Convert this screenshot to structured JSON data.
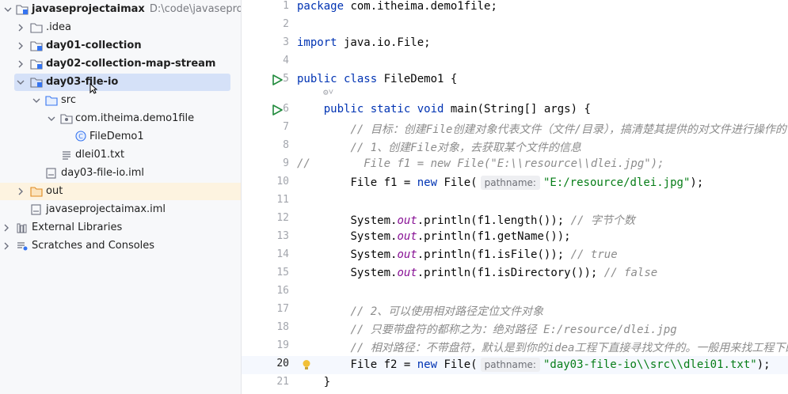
{
  "project_tree": {
    "root": {
      "name": "javaseprojectaimax",
      "path": "D:\\code\\javaseprojectai"
    },
    "items": [
      {
        "label": ".idea"
      },
      {
        "label": "day01-collection"
      },
      {
        "label": "day02-collection-map-stream"
      },
      {
        "label": "day03-file-io"
      },
      {
        "label": "src"
      },
      {
        "label": "com.itheima.demo1file"
      },
      {
        "label": "FileDemo1"
      },
      {
        "label": "dlei01.txt"
      },
      {
        "label": "day03-file-io.iml"
      },
      {
        "label": "out"
      },
      {
        "label": "javaseprojectaimax.iml"
      },
      {
        "label": "External Libraries"
      },
      {
        "label": "Scratches and Consoles"
      }
    ]
  },
  "editor": {
    "line_numbers": [
      "1",
      "2",
      "3",
      "4",
      "5",
      "6",
      "7",
      "8",
      "9",
      "10",
      "11",
      "12",
      "13",
      "14",
      "15",
      "16",
      "17",
      "18",
      "19",
      "20",
      "21"
    ],
    "code": {
      "l1_kw": "package",
      "l1_rest": " com.itheima.demo1file;",
      "l3_kw": "import",
      "l3_rest": " java.io.File;",
      "l5_kw": "public class",
      "l5_rest": " FileDemo1 {",
      "l5b": "⚙˅",
      "l6_kw": "public static void",
      "l6_rest": " main(String[] args) {",
      "l7_cmt": "// 目标：创建File创建对象代表文件（文件/目录），搞清楚其提供的对文件进行操作的",
      "l8_cmt": "// 1、创建File对象，去获取某个文件的信息",
      "l9_cmt": "//        File f1 = new File(\"E:\\\\resource\\\\dlei.jpg\");",
      "l10_a": "File f1 = ",
      "l10_kw": "new",
      "l10_b": " File(",
      "l10_hint": "pathname:",
      "l10_str": "\"E:/resource/dlei.jpg\"",
      "l10_c": ");",
      "l12_a": "System.",
      "l12_out": "out",
      "l12_b": ".println(f1.length()); ",
      "l12_cmt": "// 字节个数",
      "l13_a": "System.",
      "l13_out": "out",
      "l13_b": ".println(f1.getName());",
      "l14_a": "System.",
      "l14_out": "out",
      "l14_b": ".println(f1.isFile()); ",
      "l14_cmt": "// true",
      "l15_a": "System.",
      "l15_out": "out",
      "l15_b": ".println(f1.isDirectory()); ",
      "l15_cmt": "// false",
      "l17_cmt": "// 2、可以使用相对路径定位文件对象",
      "l18_cmt": "// 只要带盘符的都称之为：绝对路径 E:/resource/dlei.jpg",
      "l19_cmt": "// 相对路径：不带盘符，默认是到你的idea工程下直接寻找文件的。一般用来找工程下的",
      "l20_a": "File f2 = ",
      "l20_kw": "new",
      "l20_b": " File(",
      "l20_hint": "pathname:",
      "l20_str": "\"day03-file-io\\\\src\\\\dlei01.txt\"",
      "l20_c": ");",
      "l21": "}"
    }
  }
}
